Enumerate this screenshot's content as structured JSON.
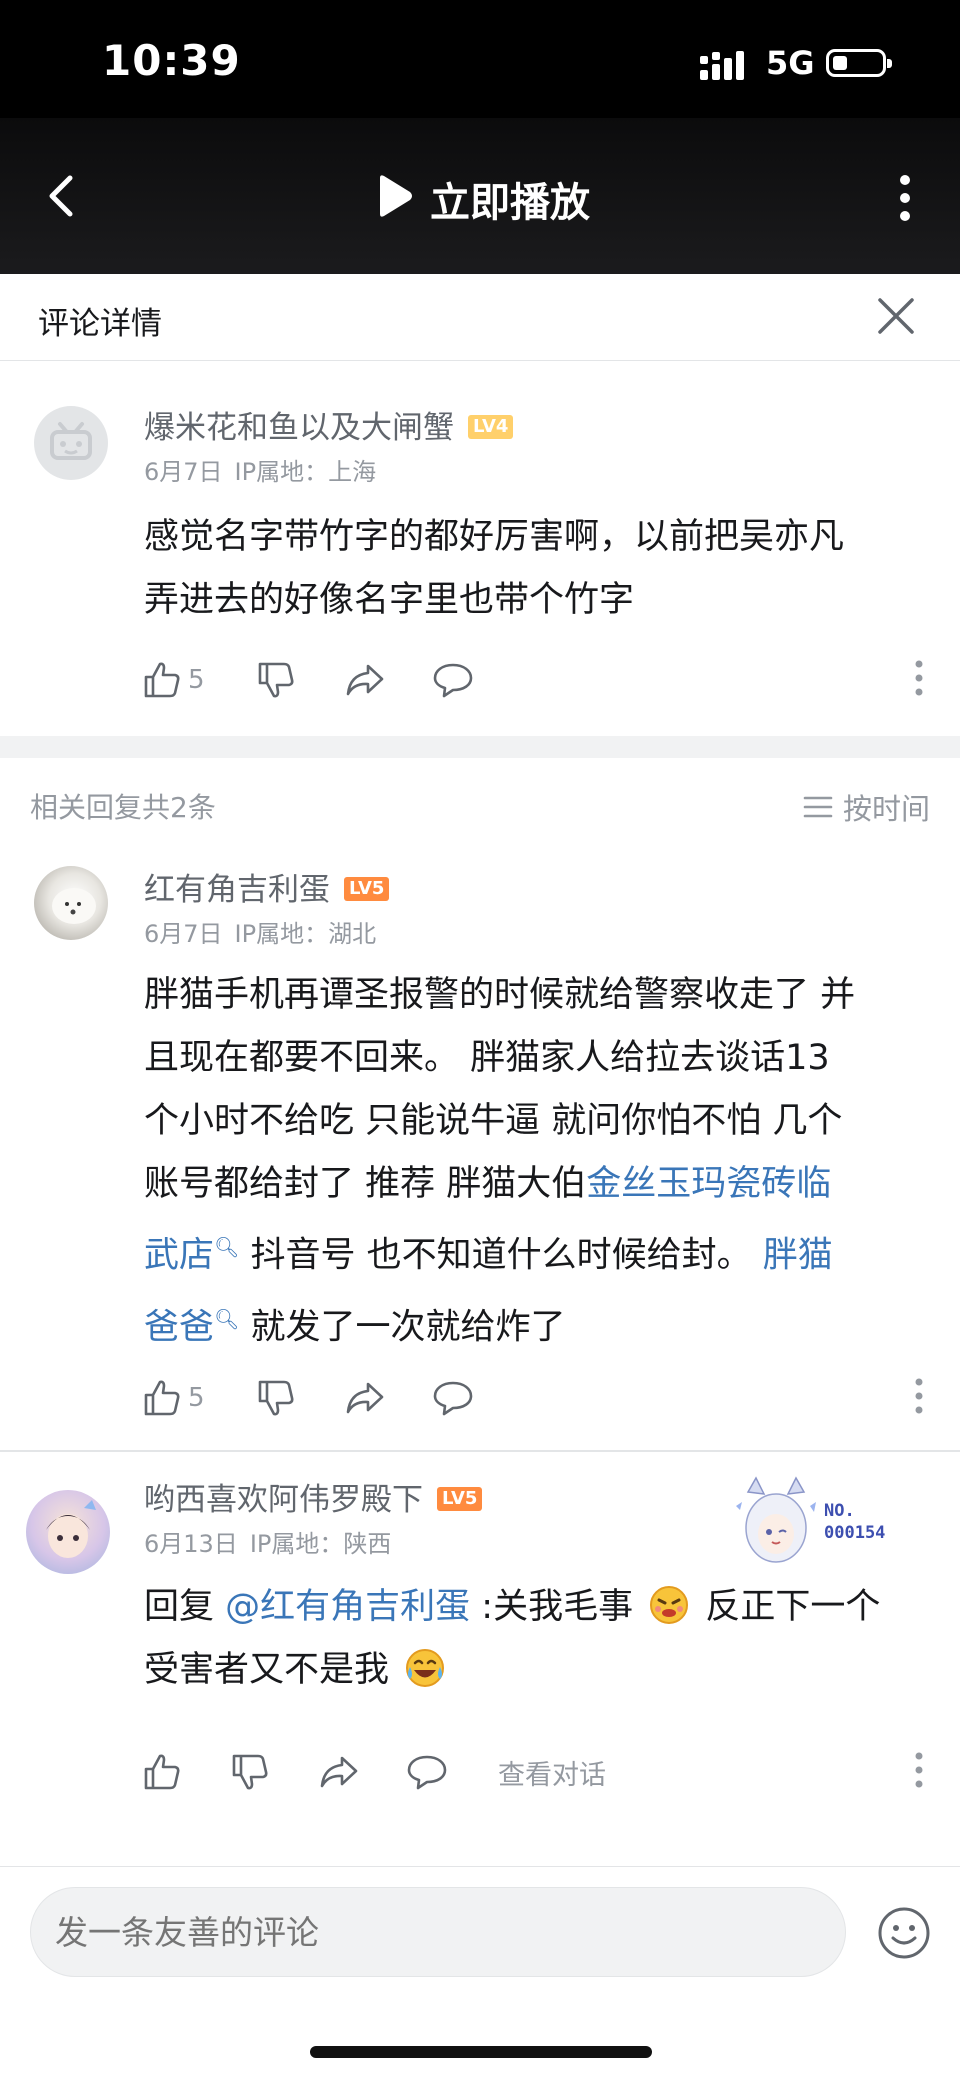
{
  "status": {
    "time": "10:39",
    "network": "5G"
  },
  "player": {
    "play_label": "立即播放"
  },
  "detail": {
    "title": "评论详情"
  },
  "main_comment": {
    "user": "爆米花和鱼以及大闸蟹",
    "level": "LV4",
    "date": "6月7日",
    "ip": "IP属地：上海",
    "text_lines": [
      "感觉名字带竹字的都好厉害啊，以前把吴亦凡",
      "弄进去的好像名字里也带个竹字"
    ],
    "likes": "5"
  },
  "replies_header": {
    "count": "相关回复共2条",
    "sort": "按时间"
  },
  "reply1": {
    "user": "红有角吉利蛋",
    "level": "LV5",
    "date": "6月7日",
    "ip": "IP属地：湖北",
    "line1": "胖猫手机再谭圣报警的时候就给警察收走了  并",
    "line2": "且现在都要不回来。  胖猫家人给拉去谈话13",
    "line3": "个小时不给吃  只能说牛逼  就问你怕不怕  几个",
    "line4a": "账号都给封了  推荐 胖猫大伯",
    "link1a": "金丝玉玛瓷砖临",
    "link1b": "武店",
    "line5b": " 抖音号  也不知道什么时候给封。 ",
    "link2a": "胖猫",
    "link2b": "爸爸",
    "line6b": " 就发了一次就给炸了",
    "likes": "5"
  },
  "reply2": {
    "user": "哟西喜欢阿伟罗殿下",
    "level": "LV5",
    "date": "6月13日",
    "ip": "IP属地：陕西",
    "prefix": "回复 ",
    "mention": "@红有角吉利蛋",
    "text_a": " :关我毛事",
    "text_b": "反正下一个",
    "line2": "受害者又不是我",
    "view_conversation": "查看对话",
    "badge_no": "NO.",
    "badge_num": "000154"
  },
  "composer": {
    "placeholder": "发一条友善的评论"
  }
}
